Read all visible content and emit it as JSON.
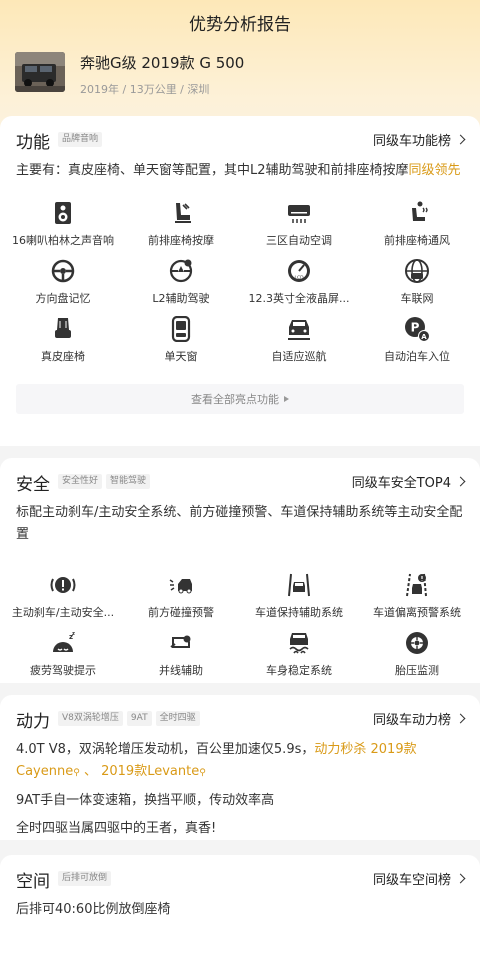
{
  "page": {
    "title": "优势分析报告"
  },
  "car": {
    "name": "奔驰G级 2019款 G 500",
    "meta": "2019年 / 13万公里 / 深圳"
  },
  "function": {
    "title": "功能",
    "tags": [
      "品牌音响"
    ],
    "rank": "同级车功能榜",
    "desc_prefix": "主要有：真皮座椅、单天窗等配置，其中L2辅助驾驶和前排座椅按摩",
    "desc_highlight": "同级领先",
    "features": [
      {
        "label": "16喇叭柏林之声音响",
        "icon": "speaker-icon"
      },
      {
        "label": "前排座椅按摩",
        "icon": "seat-massage-icon"
      },
      {
        "label": "三区自动空调",
        "icon": "ac-icon"
      },
      {
        "label": "前排座椅通风",
        "icon": "seat-ventilation-icon"
      },
      {
        "label": "方向盘记忆",
        "icon": "steering-memory-icon"
      },
      {
        "label": "L2辅助驾驶",
        "icon": "assist-driving-icon"
      },
      {
        "label": "12.3英寸全液晶屏...",
        "icon": "lcd-gauge-icon"
      },
      {
        "label": "车联网",
        "icon": "connected-car-icon"
      },
      {
        "label": "真皮座椅",
        "icon": "leather-seat-icon"
      },
      {
        "label": "单天窗",
        "icon": "sunroof-icon"
      },
      {
        "label": "自适应巡航",
        "icon": "adaptive-cruise-icon"
      },
      {
        "label": "自动泊车入位",
        "icon": "auto-parking-icon"
      }
    ],
    "more": "查看全部亮点功能"
  },
  "safety": {
    "title": "安全",
    "tags": [
      "安全性好",
      "智能驾驶"
    ],
    "rank": "同级车安全TOP4",
    "desc": "标配主动刹车/主动安全系统、前方碰撞预警、车道保持辅助系统等主动安全配置",
    "features": [
      {
        "label": "主动刹车/主动安全...",
        "icon": "active-brake-icon"
      },
      {
        "label": "前方碰撞预警",
        "icon": "collision-warning-icon"
      },
      {
        "label": "车道保持辅助系统",
        "icon": "lane-keep-icon"
      },
      {
        "label": "车道偏离预警系统",
        "icon": "lane-departure-icon"
      },
      {
        "label": "疲劳驾驶提示",
        "icon": "fatigue-icon"
      },
      {
        "label": "并线辅助",
        "icon": "blind-spot-icon"
      },
      {
        "label": "车身稳定系统",
        "icon": "stability-icon"
      },
      {
        "label": "胎压监测",
        "icon": "tire-pressure-icon"
      }
    ]
  },
  "power": {
    "title": "动力",
    "tags": [
      "V8双涡轮增压",
      "9AT",
      "全时四驱"
    ],
    "rank": "同级车动力榜",
    "p1_prefix": "4.0T V8，双涡轮增压发动机，百公里加速仅5.9s，",
    "p1_hl1": "动力秒杀",
    "p1_hl2": "2019款",
    "p1_hl3": "Cayenne",
    "p1_sep": "、",
    "p1_hl4": "2019款Levante",
    "p2": "9AT手自一体变速箱，换挡平顺，传动效率高",
    "p3": "全时四驱当属四驱中的王者，真香!"
  },
  "space": {
    "title": "空间",
    "tags": [
      "后排可放倒"
    ],
    "rank": "同级车空间榜",
    "desc": "后排可40:60比例放倒座椅"
  },
  "colors": {
    "accent": "#d99a17",
    "icon": "#333333"
  }
}
